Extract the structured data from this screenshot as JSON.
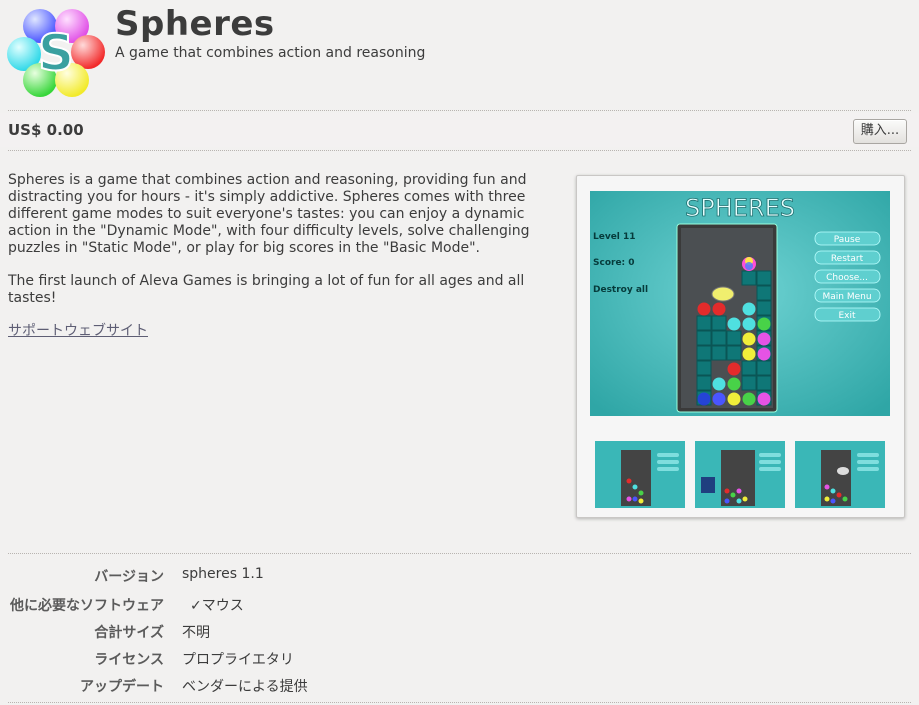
{
  "app": {
    "title": "Spheres",
    "subtitle": "A game that combines action and reasoning",
    "logo_letter": "S"
  },
  "price": {
    "label": "US$ 0.00",
    "buy_button": "購入..."
  },
  "description": {
    "paragraphs": [
      "Spheres is a game that combines action and reasoning, providing fun and distracting you for hours - it's simply addictive. Spheres comes with three different game modes to suit everyone's tastes: you can enjoy a dynamic action in the \"Dynamic Mode\", with four difficulty levels, solve challenging puzzles in \"Static Mode\", or play for big scores in the \"Basic Mode\".",
      "The first launch of Aleva Games is bringing a lot of fun for all ages and all tastes!"
    ],
    "support_link": "サポートウェブサイト"
  },
  "screenshot": {
    "game_title": "SPHERES",
    "level": "Level 11",
    "score": "Score: 0",
    "mode": "Destroy all",
    "menu": [
      "Pause",
      "Restart",
      "Choose...",
      "Main Menu",
      "Exit"
    ]
  },
  "details": {
    "rows": [
      {
        "label": "バージョン",
        "value": "spheres 1.1"
      },
      {
        "label": "他に必要なソフトウェア",
        "value": "✓マウス"
      },
      {
        "label": "合計サイズ",
        "value": "不明"
      },
      {
        "label": "ライセンス",
        "value": "プロプライエタリ"
      },
      {
        "label": "アップデート",
        "value": "ベンダーによる提供"
      }
    ]
  },
  "colors": {
    "background": "#f2f1f0",
    "game_teal": "#38b8b8",
    "text": "#3c3c3c"
  }
}
